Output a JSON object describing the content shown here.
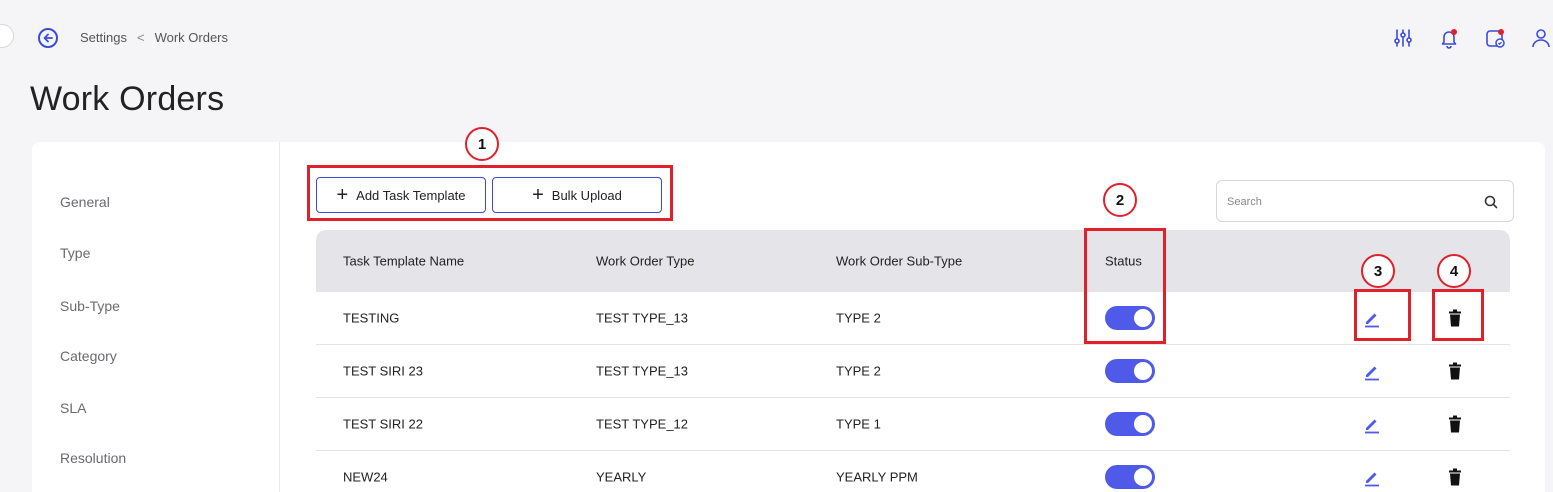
{
  "breadcrumb": {
    "parent": "Settings",
    "separator": "<",
    "current": "Work Orders"
  },
  "page_title": "Work Orders",
  "sidebar": {
    "items": [
      {
        "label": "General"
      },
      {
        "label": "Type"
      },
      {
        "label": "Sub-Type"
      },
      {
        "label": "Category"
      },
      {
        "label": "SLA"
      },
      {
        "label": "Resolution"
      }
    ]
  },
  "toolbar": {
    "add_task_template_label": "Add Task Template",
    "bulk_upload_label": "Bulk Upload"
  },
  "search": {
    "placeholder": "Search"
  },
  "table": {
    "columns": {
      "name": "Task Template Name",
      "type": "Work Order Type",
      "subtype": "Work Order Sub-Type",
      "status": "Status"
    },
    "rows": [
      {
        "name": "TESTING",
        "type": "TEST TYPE_13",
        "subtype": "TYPE 2",
        "status_on": true
      },
      {
        "name": "TEST SIRI 23",
        "type": "TEST TYPE_13",
        "subtype": "TYPE 2",
        "status_on": true
      },
      {
        "name": "TEST SIRI 22",
        "type": "TEST TYPE_12",
        "subtype": "TYPE 1",
        "status_on": true
      },
      {
        "name": "NEW24",
        "type": "YEARLY",
        "subtype": "YEARLY PPM",
        "status_on": true
      }
    ]
  },
  "annotations": [
    "1",
    "2",
    "3",
    "4"
  ],
  "colors": {
    "accent": "#3a4bd8",
    "toggle": "#4f5be8",
    "annotation": "#e0202a"
  },
  "icons": [
    "back-arrow-icon",
    "sliders-icon",
    "bell-icon",
    "task-icon",
    "user-icon",
    "plus-icon",
    "search-icon",
    "edit-icon",
    "delete-icon"
  ]
}
